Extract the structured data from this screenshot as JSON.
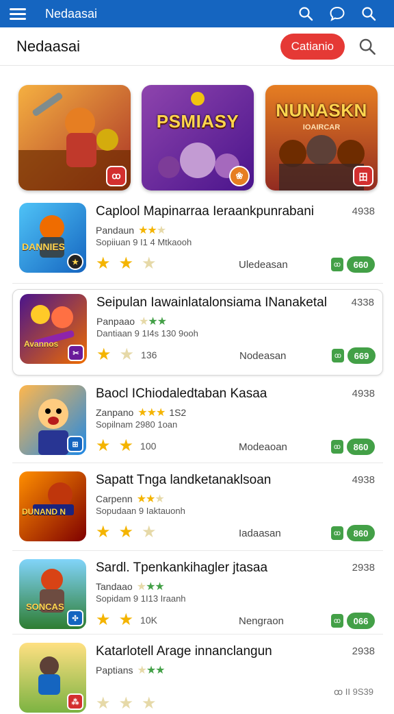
{
  "statusbar": {
    "title": "Nedaasai",
    "icons": [
      "menu-icon",
      "search-icon",
      "chat-icon",
      "search-icon"
    ]
  },
  "header": {
    "title": "Nedaasai",
    "category_button": "Catianio"
  },
  "featured": [
    {
      "label": "",
      "sub": "",
      "badge": "ꝏ",
      "colors": [
        "#c5522a",
        "#f0a03a"
      ]
    },
    {
      "label": "PSMIASY",
      "sub": "",
      "badge": "❀",
      "colors": [
        "#6a1fb0",
        "#b45ad8"
      ]
    },
    {
      "label": "NUNASKN",
      "sub": "IOAIRCAR",
      "badge": "田",
      "colors": [
        "#c8401a",
        "#f09a2c"
      ]
    }
  ],
  "items": [
    {
      "name": "Caplool Mapinarraa Ieraankpunrabani",
      "count": "4938",
      "dev": "Pandaun",
      "meta": "Sopiiuan 9 I1 4 Mtkaooh",
      "rcount": "",
      "label": "Uledeasan",
      "price": "660",
      "thumb_text": "DANNIES",
      "badge": "★",
      "colors": [
        "#1976d2",
        "#4fc3f7"
      ],
      "badge_color": "#222"
    },
    {
      "name": "Seipulan Iawainlatalonsiama INanaketal",
      "count": "4338",
      "dev": "Panpaao",
      "meta": "Dantiaan 9 1I4s 130 9ooh",
      "rcount": "136",
      "label": "Nodeasan",
      "price": "669",
      "thumb_text": "Avannos",
      "badge": "✂",
      "colors": [
        "#4a148c",
        "#ef6c00"
      ],
      "badge_color": "#6a1b9a"
    },
    {
      "name": "Baocl IChiodaledtaban Kasaa",
      "count": "4938",
      "dev": "Zanpano",
      "meta": "Sopilnam 2980 1oan",
      "rcount": "100",
      "label": "Modeaoan",
      "price": "860",
      "thumb_text": "",
      "badge": "⊞",
      "colors": [
        "#1e88e5",
        "#ffb74d"
      ],
      "badge_color": "#1565c0",
      "dev_extra": "1S2"
    },
    {
      "name": "Sapatt Tnga landketanaklsoan",
      "count": "4938",
      "dev": "Carpenn",
      "meta": "Sopudaan 9 Iaktauonh",
      "rcount": "",
      "label": "Iadaasan",
      "price": "860",
      "thumb_text": "DUNAND N",
      "badge": "",
      "colors": [
        "#b71c1c",
        "#ff8f00"
      ],
      "badge_color": "#b71c1c"
    },
    {
      "name": "Sardl. Tpenkankihagler jtasaa",
      "count": "2938",
      "dev": "Tandaao",
      "meta": "Sopidam 9 1I13 Iraanh",
      "rcount": "10K",
      "label": "Nengraon",
      "price": "066",
      "thumb_text": "SONCAS",
      "badge": "✣",
      "colors": [
        "#2e7d32",
        "#66bb6a"
      ],
      "badge_color": "#1565c0"
    },
    {
      "name": "Katarlotell Arage innanclangun",
      "count": "2938",
      "dev": "Paptians",
      "meta": "",
      "rcount": "",
      "label": "",
      "price": "",
      "thumb_text": "",
      "badge": "⁂",
      "colors": [
        "#8bc34a",
        "#ffca28"
      ],
      "badge_color": "#d32f2f",
      "footer": "ꝏ II 9S39"
    }
  ]
}
